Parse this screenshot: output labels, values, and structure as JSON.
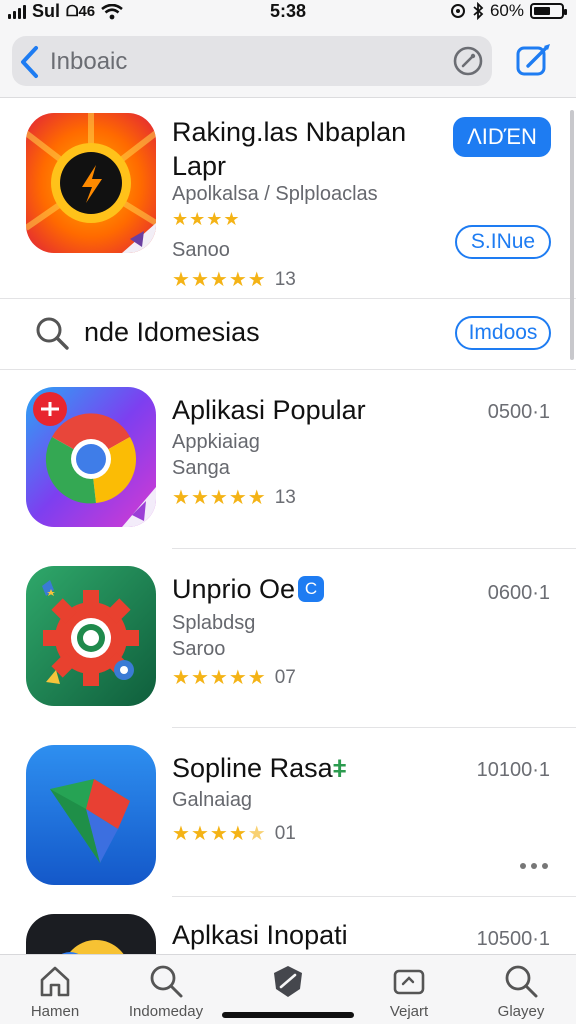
{
  "status_bar": {
    "carrier": "Sul",
    "network": "ᗝ46",
    "time": "5:38",
    "battery": "60%"
  },
  "header": {
    "search_text": "Inboaic",
    "back_icon": "chevron-left-icon",
    "clear_icon": "clear-icon",
    "compose_icon": "compose-icon"
  },
  "featured_app": {
    "name_line1": "Raking.las Nbaplan",
    "name_line2": "Lapr",
    "category": "Apolkalsa / Splploaclas",
    "developer": "Sanoo",
    "rating_count": "13",
    "get_button": "ΛΙDΈΝ",
    "secondary_button": "S.INue"
  },
  "suggestion": {
    "text": "nde Idomesias",
    "button": "Imdoos"
  },
  "apps": [
    {
      "name": "Aplikasi Popular",
      "line2": "Appkiaiag",
      "line3": "Sanga",
      "rating_count": "13",
      "value": "0500·1"
    },
    {
      "name": "Unprio Oe",
      "line2": "Splabdsg",
      "line3": "Saroo",
      "rating_count": "07",
      "value": "0600·1"
    },
    {
      "name": "Sopline Rasa",
      "line2": "Galnaiag",
      "line3": "",
      "rating_count": "01",
      "value": "10100·1"
    },
    {
      "name": "Aplkasi Inopati",
      "line2": "",
      "line3": "",
      "rating_count": "",
      "value": "10500·1"
    }
  ],
  "tabs": [
    {
      "label": "Hamen",
      "icon": "home-icon"
    },
    {
      "label": "Indomeday",
      "icon": "search-icon"
    },
    {
      "label": "",
      "icon": "shield-icon"
    },
    {
      "label": "Vejart",
      "icon": "wallet-icon"
    },
    {
      "label": "Glayey",
      "icon": "search-icon"
    }
  ],
  "colors": {
    "accent": "#1e7cf2",
    "star": "#f4b316",
    "background": "#ffffff",
    "bar_background": "#f6f6f7"
  }
}
